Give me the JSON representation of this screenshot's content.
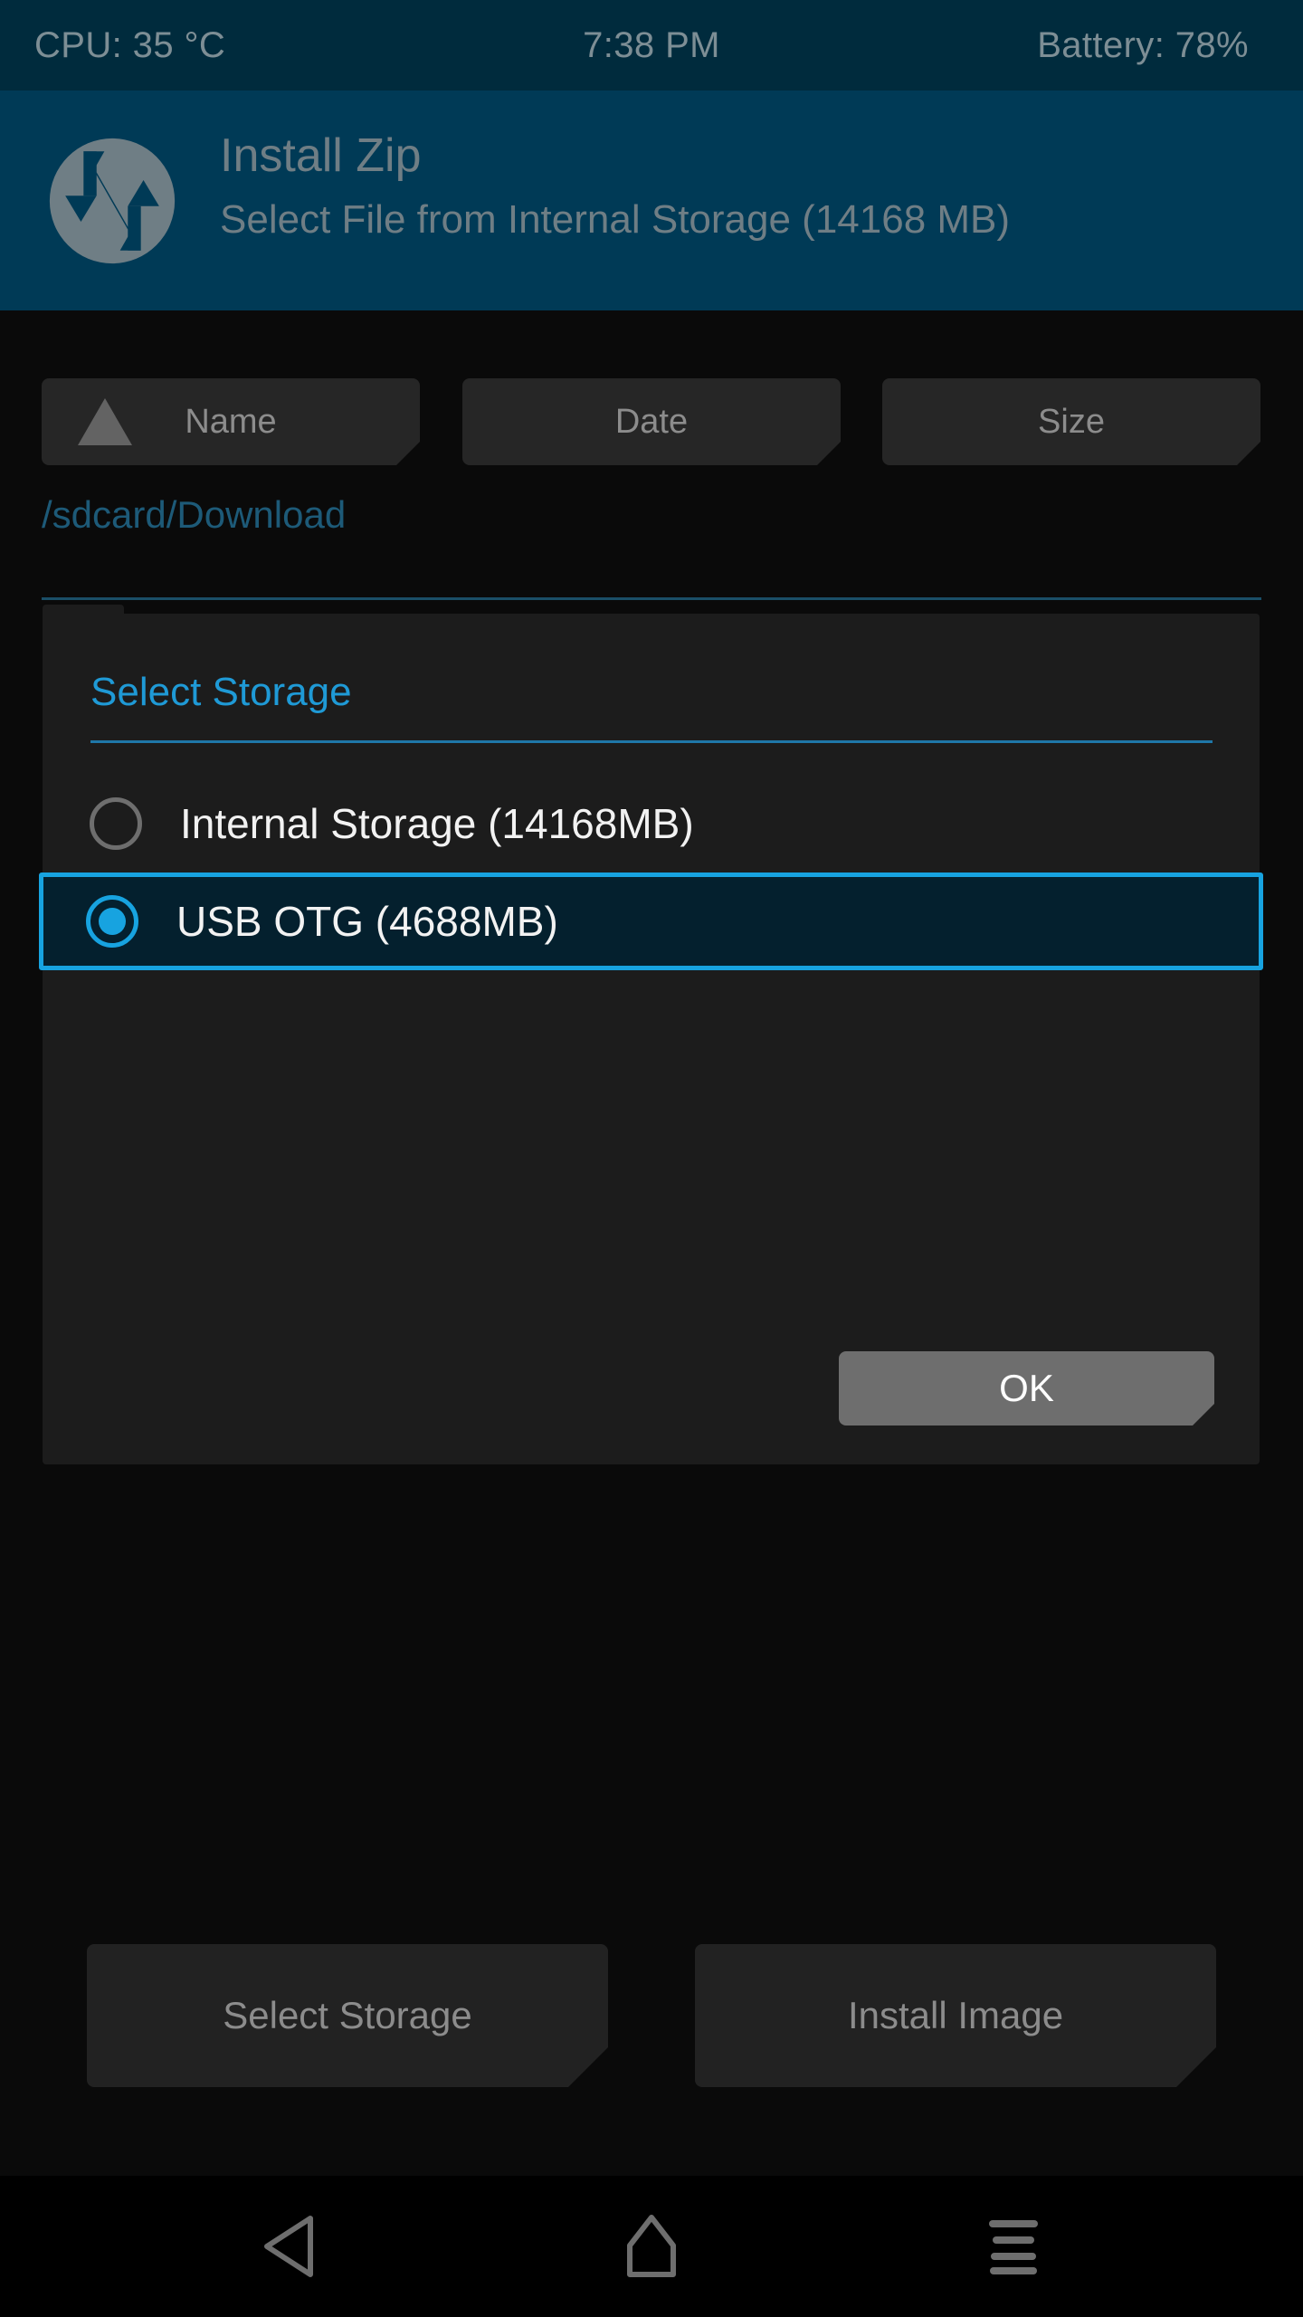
{
  "status_bar": {
    "cpu": "CPU: 35 °C",
    "clock": "7:38 PM",
    "battery": "Battery: 78%"
  },
  "header": {
    "logo_icon": "twrp-logo-icon",
    "title": "Install Zip",
    "subtitle": "Select File from Internal Storage (14168 MB)"
  },
  "sort_bar": {
    "sort_direction_icon": "triangle-up-icon",
    "buttons": [
      {
        "label": "Name"
      },
      {
        "label": "Date"
      },
      {
        "label": "Size"
      }
    ]
  },
  "file_browser": {
    "path": "/sdcard/Download"
  },
  "dialog": {
    "title": "Select Storage",
    "options": [
      {
        "label": "Internal Storage (14168MB)",
        "selected": false
      },
      {
        "label": "USB OTG (4688MB)",
        "selected": true
      }
    ],
    "ok_label": "OK"
  },
  "actions": {
    "select_storage_label": "Select Storage",
    "install_image_label": "Install Image"
  },
  "nav_bar": {
    "back_icon": "back-triangle-icon",
    "home_icon": "home-icon",
    "recents_icon": "menu-lines-icon"
  },
  "colors": {
    "status_bar_bg": "#002b3d",
    "header_bg": "#003a56",
    "accent_blue": "#17a3e0",
    "title_blue": "#1f9ad6",
    "path_blue": "#1d5a78",
    "dialog_bg": "#1c1c1c",
    "selected_row_bg": "#04202e",
    "button_bg": "#262626",
    "ok_button_bg": "#6e6e6e",
    "muted_text": "#8c8c8c",
    "header_text": "#6f7e85"
  }
}
